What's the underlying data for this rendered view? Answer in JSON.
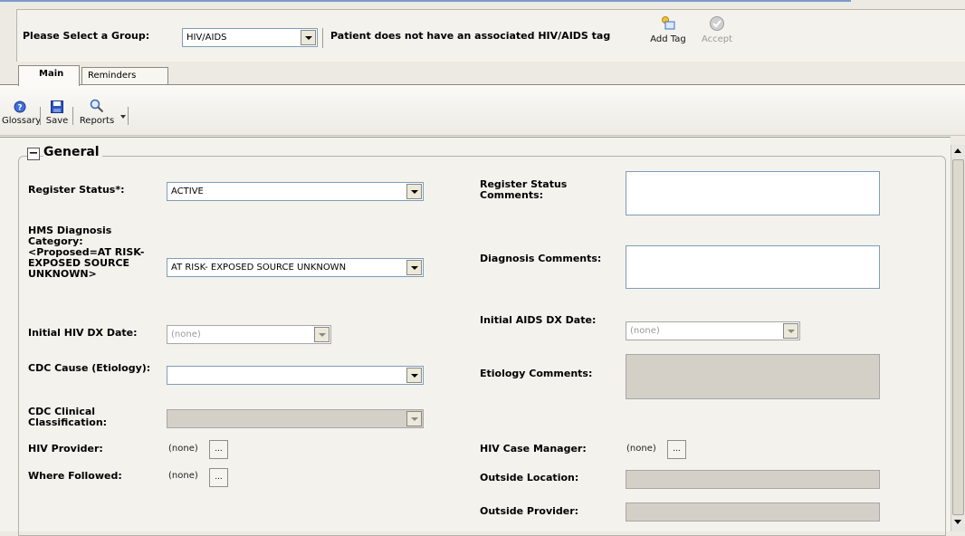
{
  "group_bar": {
    "label": "Please Select a Group:",
    "selected_group": "HIV/AIDS",
    "status_message": "Patient does not have an associated HIV/AIDS tag",
    "add_tag_label": "Add Tag",
    "accept_label": "Accept"
  },
  "tabs": [
    {
      "label": "Main",
      "active": true
    },
    {
      "label": "Reminders",
      "active": false
    }
  ],
  "toolbar": {
    "glossary_label": "Glossary",
    "save_label": "Save",
    "reports_label": "Reports"
  },
  "section": {
    "title": "General",
    "collapse_symbol": "−"
  },
  "form": {
    "register_status": {
      "label": "Register Status*:",
      "value": "ACTIVE"
    },
    "register_status_comments": {
      "label": "Register Status Comments:"
    },
    "hms_diagnosis": {
      "label": "HMS Diagnosis Category: <Proposed=AT RISK- EXPOSED SOURCE UNKNOWN>",
      "value": "AT RISK- EXPOSED SOURCE UNKNOWN"
    },
    "diagnosis_comments": {
      "label": "Diagnosis Comments:"
    },
    "initial_hiv_dx_date": {
      "label": "Initial HIV DX Date:",
      "value": "(none)"
    },
    "initial_aids_dx_date": {
      "label": "Initial AIDS DX Date:",
      "value": "(none)"
    },
    "cdc_cause": {
      "label": "CDC Cause (Etiology):",
      "value": ""
    },
    "etiology_comments": {
      "label": "Etiology Comments:"
    },
    "cdc_clinical": {
      "label": "CDC Clinical Classification:",
      "value": ""
    },
    "hiv_provider": {
      "label": "HIV Provider:",
      "value": "(none)"
    },
    "hiv_case_manager": {
      "label": "HIV Case Manager:",
      "value": "(none)"
    },
    "where_followed": {
      "label": "Where Followed:",
      "value": "(none)"
    },
    "outside_location": {
      "label": "Outside Location:"
    },
    "outside_provider": {
      "label": "Outside Provider:"
    },
    "ellipsis": "..."
  },
  "icons": {
    "glossary": "help-icon",
    "save": "floppy-disk-icon",
    "reports": "magnifier-icon",
    "add_tag": "add-tag-icon",
    "accept": "checkmark-icon"
  },
  "colors": {
    "background": "#eceae2",
    "disabled_field": "#d4d0c8",
    "field_border": "#7f9db9"
  }
}
